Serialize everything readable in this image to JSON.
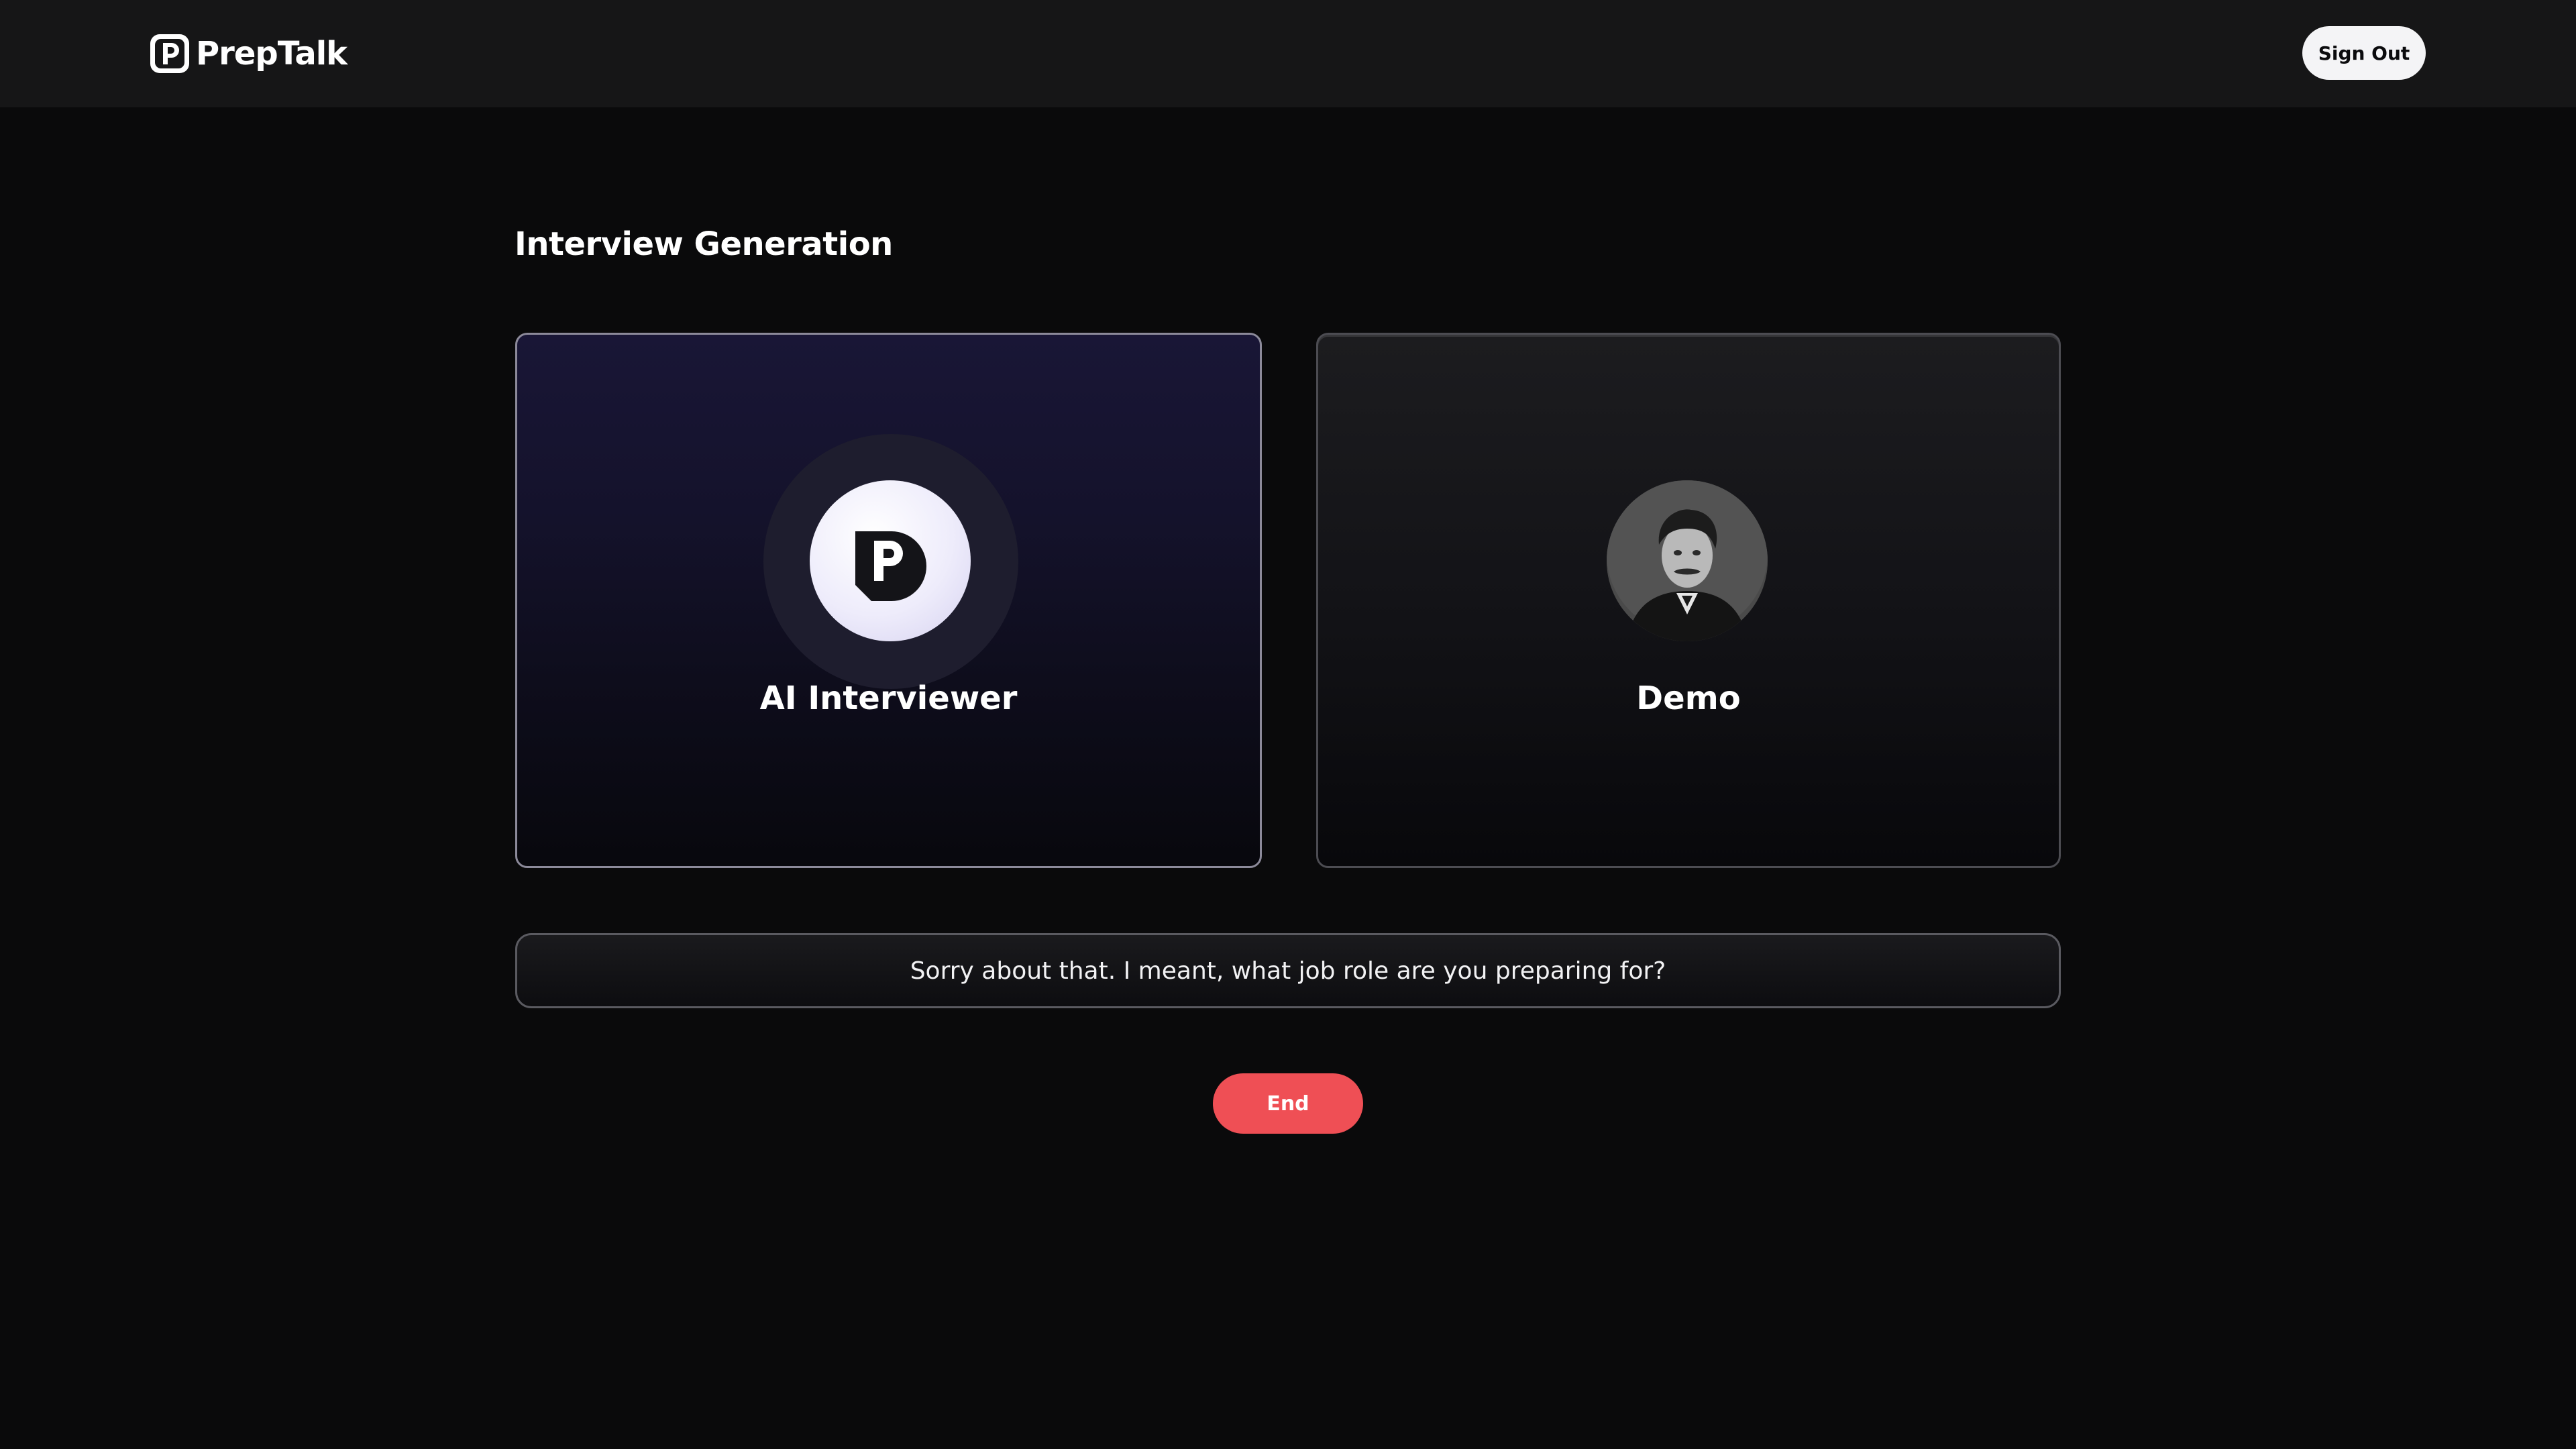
{
  "header": {
    "brand_name": "PrepTalk",
    "sign_out_label": "Sign Out"
  },
  "main": {
    "title": "Interview Generation",
    "cards": [
      {
        "label": "AI Interviewer",
        "avatar_icon": "preptalk-logo-icon"
      },
      {
        "label": "Demo",
        "avatar_icon": "user-photo-avatar"
      }
    ],
    "transcript_text": "Sorry about that. I meant, what job role are you preparing for?",
    "end_label": "End"
  },
  "colors": {
    "background": "#0a0a0b",
    "topbar": "#161617",
    "end_button": "#ef4f55",
    "ai_card_tint": "#191636"
  }
}
